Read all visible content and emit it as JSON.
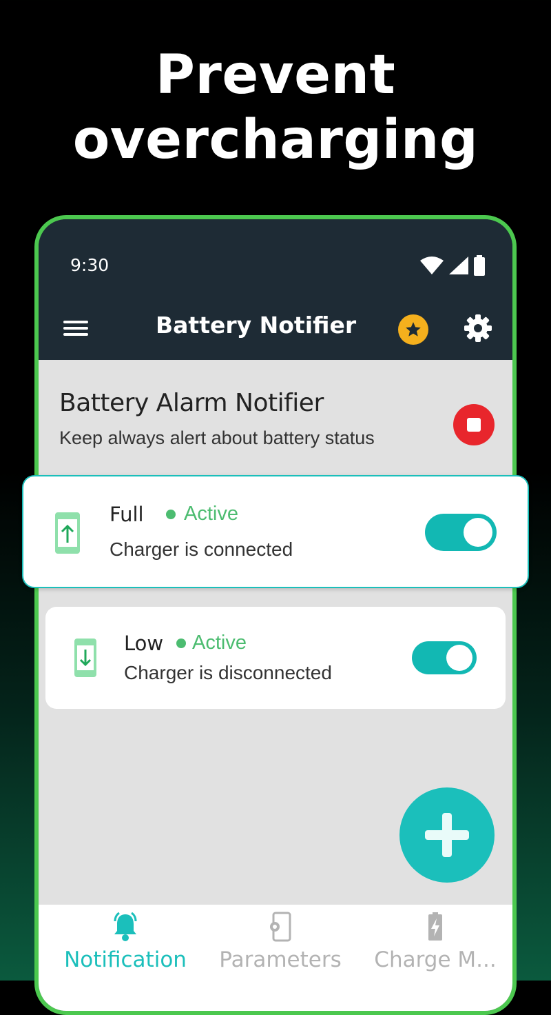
{
  "headline": {
    "line1": "Prevent",
    "line2": "overcharging"
  },
  "status_bar": {
    "time": "9:30"
  },
  "app_bar": {
    "title": "Battery Notifier"
  },
  "header": {
    "title": "Battery Alarm Notifier",
    "subtitle": "Keep always alert about battery status"
  },
  "alarms": [
    {
      "label": "Full",
      "status": "Active",
      "description": "Charger is connected",
      "enabled": true,
      "icon": "battery-charging-up-icon"
    },
    {
      "label": "Low",
      "status": "Active",
      "description": "Charger is disconnected",
      "enabled": true,
      "icon": "battery-charging-down-icon"
    }
  ],
  "bottom_nav": {
    "items": [
      {
        "label": "Notification",
        "icon": "bell-icon",
        "active": true
      },
      {
        "label": "Parameters",
        "icon": "phone-settings-icon",
        "active": false
      },
      {
        "label": "Charge M...",
        "icon": "battery-charge-icon",
        "active": false
      }
    ]
  },
  "colors": {
    "accent": "#1bbfbb",
    "border_green": "#4cc84f",
    "status_green": "#4cbc70",
    "stop_red": "#e8262c",
    "premium_yellow": "#f5b01d",
    "app_bar": "#1e2b35",
    "nav_inactive": "#b3b3b3"
  }
}
